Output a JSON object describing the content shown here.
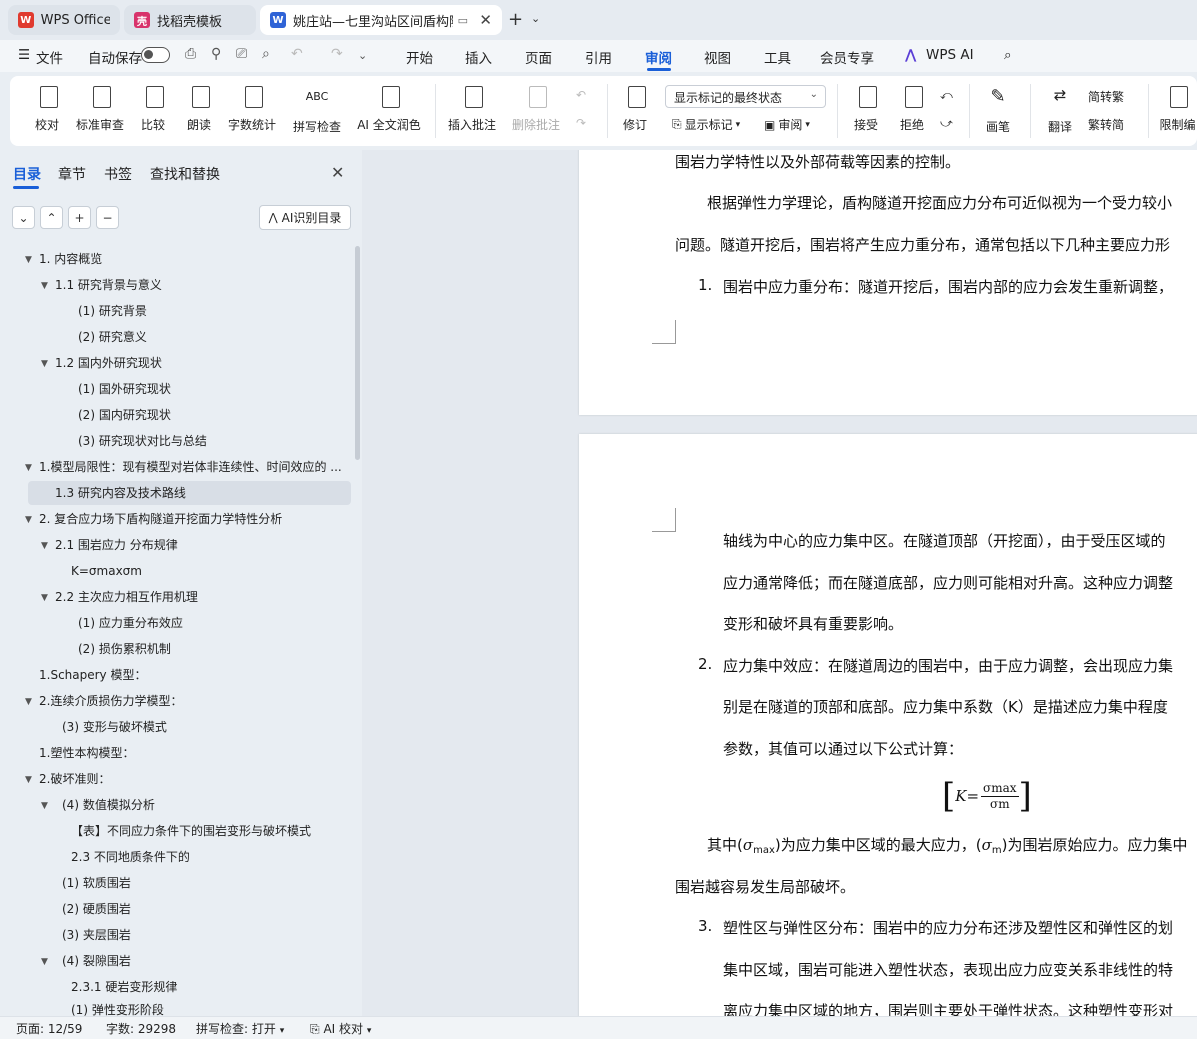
{
  "tabs": [
    {
      "label": "WPS Office"
    },
    {
      "label": "找稻壳模板"
    },
    {
      "label": "姚庄站—七里沟站区间盾构隧"
    }
  ],
  "menubar": {
    "file": "文件",
    "autosave": "自动保存",
    "items": [
      "开始",
      "插入",
      "页面",
      "引用",
      "审阅",
      "视图",
      "工具",
      "会员专享",
      "WPS AI"
    ],
    "active": "审阅"
  },
  "ribbon": {
    "proof": "校对",
    "std_review": "标准审查",
    "compare": "比较",
    "read_aloud": "朗读",
    "word_count": "字数统计",
    "spell_check": "拼写检查",
    "ai_polish": "AI 全文润色",
    "insert_comment": "插入批注",
    "delete_comment": "删除批注",
    "revise": "修订",
    "markup_select": "显示标记的最终状态",
    "show_markup": "显示标记",
    "review": "审阅",
    "accept": "接受",
    "reject": "拒绝",
    "pen": "画笔",
    "translate": "翻译",
    "to_trad": "简转繁",
    "to_simp": "繁转简",
    "restrict": "限制编"
  },
  "panel": {
    "tabs": [
      "目录",
      "章节",
      "书签",
      "查找和替换"
    ],
    "ai_toc": "AI识别目录",
    "toc": [
      "1. 内容概览",
      "1.1  研究背景与意义",
      "(1)  研究背景",
      "(2)  研究意义",
      "1.2  国内外研究现状",
      "(1)  国外研究现状",
      "(2)  国内研究现状",
      "(3)  研究现状对比与总结",
      "1.模型局限性：现有模型对岩体非连续性、时间效应的 ...",
      "1.3  研究内容及技术路线",
      "2.  复合应力场下盾构隧道开挖面力学特性分析",
      "2.1  围岩应力  分布规律",
      "K=σmaxσm",
      "2.2  主次应力相互作用机理",
      "(1)  应力重分布效应",
      "(2)  损伤累积机制",
      "1.Schapery 模型：",
      "2.连续介质损伤力学模型：",
      "(3)  变形与破坏模式",
      "1.塑性本构模型：",
      "2.破坏准则：",
      "(4)  数值模拟分析",
      "【表】不同应力条件下的围岩变形与破坏模式",
      "2.3  不同地质条件下的",
      "(1)  软质围岩",
      "(2)  硬质围岩",
      "(3)  夹层围岩",
      "(4)  裂隙围岩",
      "2.3.1  硬岩变形规律",
      "(1)  弹性变形阶段"
    ]
  },
  "doc": {
    "p1_l1": "围岩力学特性以及外部荷载等因素的控制。",
    "p1_l2": "根据弹性力学理论，盾构隧道开挖面应力分布可近似视为一个受力较小",
    "p1_l3": "问题。隧道开挖后，围岩将产生应力重分布，通常包括以下几种主要应力形",
    "p1_n1": "1.",
    "p1_l4": "围岩中应力重分布：隧道开挖后，围岩内部的应力会发生重新调整，",
    "p2_l1": "轴线为中心的应力集中区。在隧道顶部（开挖面），由于受压区域的",
    "p2_l2": "应力通常降低；而在隧道底部，应力则可能相对升高。这种应力调整",
    "p2_l3": "变形和破坏具有重要影响。",
    "p2_n2": "2.",
    "p2_l4": "应力集中效应：在隧道周边的围岩中，由于应力调整，会出现应力集",
    "p2_l5": "别是在隧道的顶部和底部。应力集中系数（K）是描述应力集中程度",
    "p2_l6": "参数，其值可以通过以下公式计算：",
    "f_k": "K=",
    "f_num": "σmax",
    "f_den": "σm",
    "p2_l7a": "其中(",
    "p2_l7s1": "σ",
    "p2_l7s1sub": "max",
    "p2_l7b": ")为应力集中区域的最大应力，(",
    "p2_l7s2": "σ",
    "p2_l7s2sub": "m",
    "p2_l7c": ")为围岩原始应力。应力集中",
    "p2_l8": "围岩越容易发生局部破坏。",
    "p2_n3": "3.",
    "p2_l9": "塑性区与弹性区分布：围岩中的应力分布还涉及塑性区和弹性区的划",
    "p2_l10": "集中区域，围岩可能进入塑性状态，表现出应力应变关系非线性的特",
    "p2_l11": "离应力集中区域的地方，围岩则主要处于弹性状态。这种塑性变形对"
  },
  "status": {
    "page": "页面: 12/59",
    "words": "字数: 29298",
    "spell": "拼写检查: 打开",
    "ai_proof": "AI 校对"
  },
  "colors": {
    "accent": "#1a5fd8",
    "wps_red": "#e03a2f",
    "doc_blue": "#2f63d6"
  }
}
